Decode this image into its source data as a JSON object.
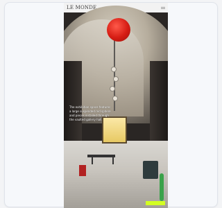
{
  "app": {
    "logo_text": "LE MONDE",
    "caption": {
      "lines": [
        "The exhibition space features",
        "a large suspended red sphere",
        "and pieces installed through",
        "the vaulted gallery hall."
      ]
    },
    "cta_label": ""
  },
  "icons": {
    "menu": "menu-icon"
  },
  "colors": {
    "accent": "#d3ff22",
    "balloon": "#d61d14"
  }
}
